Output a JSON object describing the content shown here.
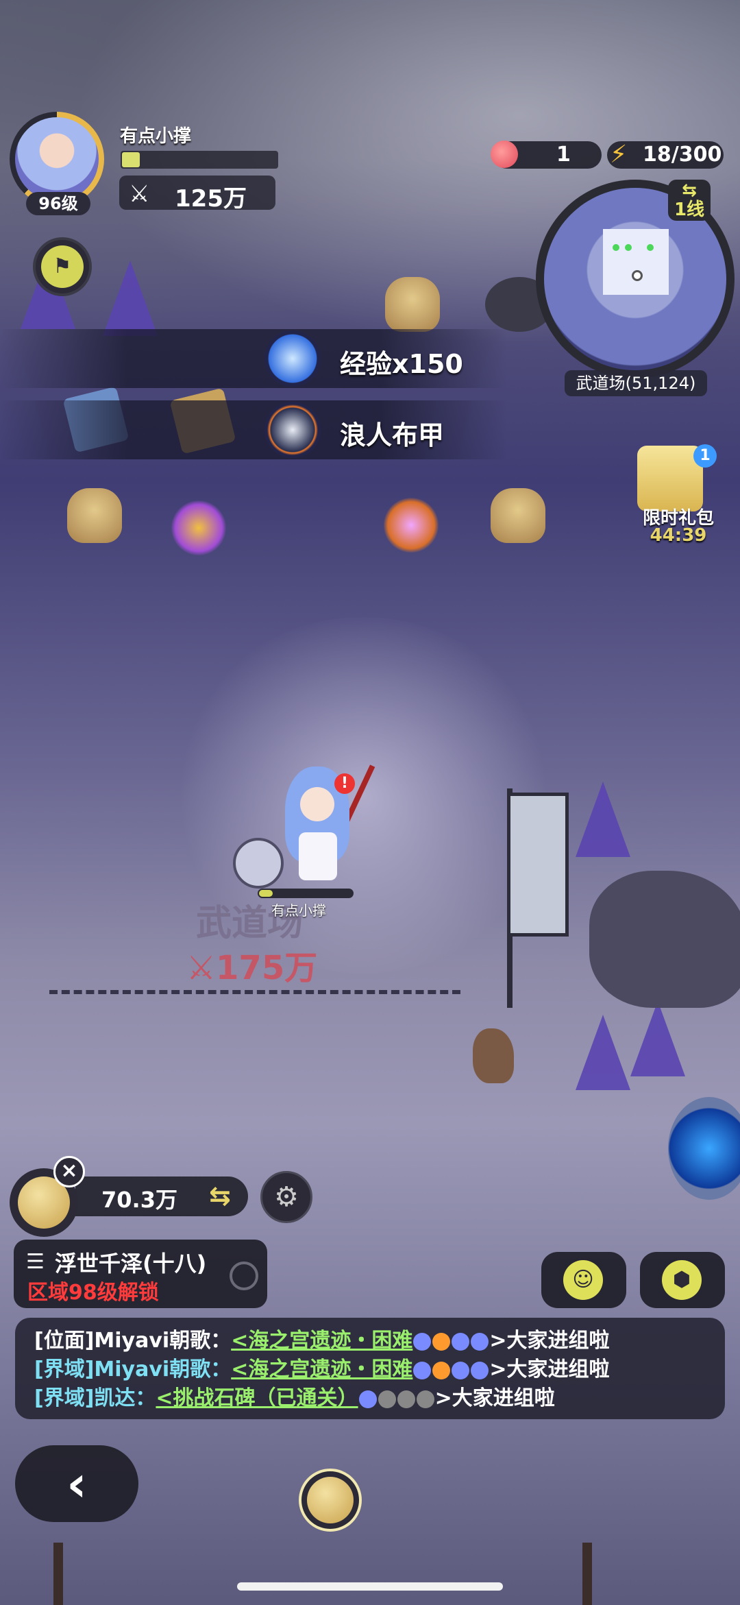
{
  "player": {
    "name": "有点小撑",
    "level": "96级",
    "power": "125万",
    "exp_fraction": 0.1
  },
  "resources": {
    "peach_count": "1",
    "energy": "18/300"
  },
  "minimap": {
    "line": "1线",
    "location": "武道场(51,124)"
  },
  "loot": [
    {
      "icon": "exp-orb-icon",
      "text": "经验x150"
    },
    {
      "icon": "armor-icon",
      "text": "浪人布甲"
    }
  ],
  "gift": {
    "badge": "1",
    "title": "限时礼包",
    "timer": "44:39"
  },
  "scene": {
    "character_name": "有点小撑",
    "alert": "!",
    "zone_name": "武道场",
    "zone_power": "175万"
  },
  "hud": {
    "gold": "70.3万",
    "close": "×",
    "swap": "⇆",
    "gear": "⚙"
  },
  "quest": {
    "name": "浮世千泽(十八)",
    "requirement": "区域98级解锁"
  },
  "chat": {
    "lines": [
      {
        "channel": "[位面]Miyavi朝歌：",
        "link": "<海之宫遗迹・困难",
        "end": ">大家进组啦"
      },
      {
        "channel": "[界域]Miyavi朝歌：",
        "link": "<海之宫遗迹・困难",
        "end": ">大家进组啦"
      },
      {
        "channel": "[界域]凯达：",
        "link": "<挑战石碑（已通关）",
        "end": ">大家进组啦"
      }
    ]
  },
  "nav": {
    "back": "‹"
  },
  "colors": {
    "accent_yellow": "#dfe05a",
    "warning_red": "#ff3b3b",
    "chat_realm": "#7fe0f4",
    "chat_link": "#9af06c"
  }
}
